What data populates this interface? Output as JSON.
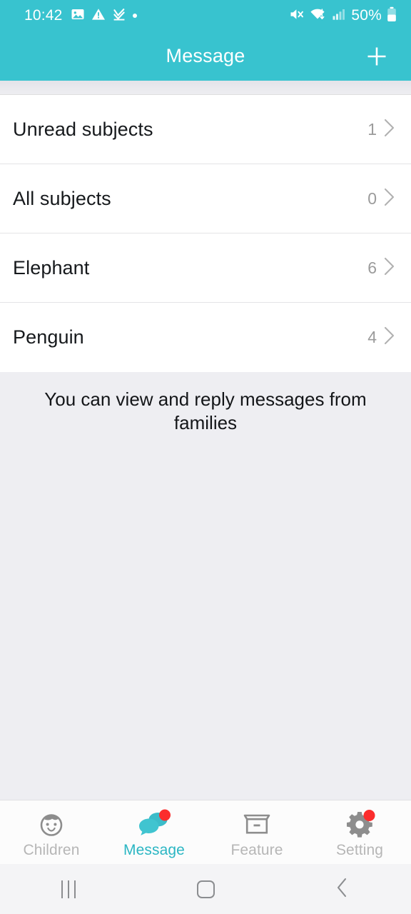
{
  "status_bar": {
    "time": "10:42",
    "battery_percent": "50%",
    "left_icons": [
      "image-icon",
      "warning-triangle-icon",
      "download-check-icon",
      "dot-icon"
    ],
    "right_icons": [
      "mute-icon",
      "wifi-icon",
      "signal-bars-icon",
      "battery-icon"
    ]
  },
  "header": {
    "title": "Message",
    "add_button": "add-icon"
  },
  "list": {
    "rows": [
      {
        "label": "Unread subjects",
        "count": "1"
      },
      {
        "label": "All subjects",
        "count": "0"
      },
      {
        "label": "Elephant",
        "count": "6"
      },
      {
        "label": "Penguin",
        "count": "4"
      }
    ]
  },
  "banner": {
    "text": "You can view and reply messages from families"
  },
  "bottom_nav": {
    "items": [
      {
        "label": "Children",
        "icon": "baby-face-icon",
        "active": false,
        "badge": false
      },
      {
        "label": "Message",
        "icon": "chat-bubbles-icon",
        "active": true,
        "badge": true
      },
      {
        "label": "Feature",
        "icon": "archive-box-icon",
        "active": false,
        "badge": false
      },
      {
        "label": "Setting",
        "icon": "gear-icon",
        "active": false,
        "badge": true
      }
    ]
  },
  "android_nav": {
    "recents_label": "recent-apps",
    "home_label": "home",
    "back_label": "back"
  },
  "colors": {
    "accent": "#38c3cf",
    "active": "#2bb6c3",
    "badge": "#fb2d2d",
    "page_bg": "#eeeef2"
  }
}
